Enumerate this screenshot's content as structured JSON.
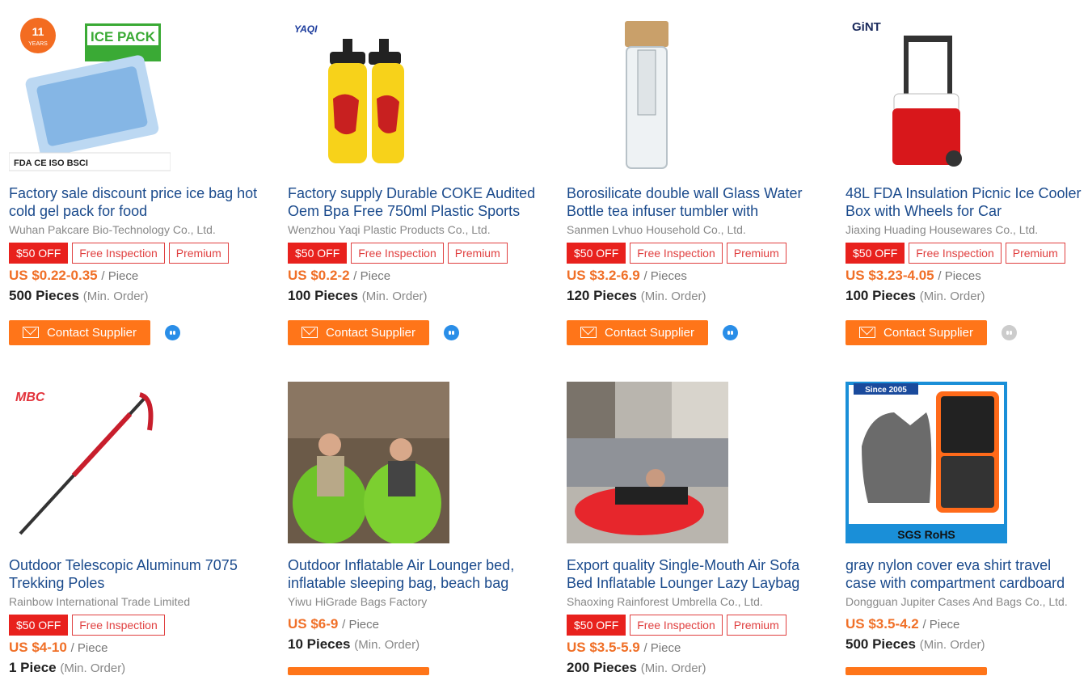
{
  "products": [
    {
      "title": "Factory sale discount price ice bag hot cold gel pack for food",
      "company": "Wuhan Pakcare Bio-Technology Co., Ltd.",
      "tags": [
        "$50 OFF",
        "Free Inspection",
        "Premium"
      ],
      "price": "US $0.22-0.35",
      "unit": "/ Piece",
      "moq": "500 Pieces",
      "moq_note": "(Min. Order)",
      "contact": "Contact Supplier",
      "chat": "blue"
    },
    {
      "title": "Factory supply Durable COKE Audited Oem Bpa Free 750ml Plastic Sports",
      "company": "Wenzhou Yaqi Plastic Products Co., Ltd.",
      "tags": [
        "$50 OFF",
        "Free Inspection",
        "Premium"
      ],
      "price": "US $0.2-2",
      "unit": "/ Piece",
      "moq": "100 Pieces",
      "moq_note": "(Min. Order)",
      "contact": "Contact Supplier",
      "chat": "blue"
    },
    {
      "title": "Borosilicate double wall Glass Water Bottle tea infuser tumbler with",
      "company": "Sanmen Lvhuo Household Co., Ltd.",
      "tags": [
        "$50 OFF",
        "Free Inspection",
        "Premium"
      ],
      "price": "US $3.2-6.9",
      "unit": "/ Pieces",
      "moq": "120 Pieces",
      "moq_note": "(Min. Order)",
      "contact": "Contact Supplier",
      "chat": "blue"
    },
    {
      "title": "48L FDA Insulation Picnic Ice Cooler Box with Wheels for Car",
      "company": "Jiaxing Huading Housewares Co., Ltd.",
      "tags": [
        "$50 OFF",
        "Free Inspection",
        "Premium"
      ],
      "price": "US $3.23-4.05",
      "unit": "/ Pieces",
      "moq": "100 Pieces",
      "moq_note": "(Min. Order)",
      "contact": "Contact Supplier",
      "chat": "gray"
    },
    {
      "title": "Outdoor Telescopic Aluminum 7075 Trekking Poles",
      "company": "Rainbow International Trade Limited",
      "tags": [
        "$50 OFF",
        "Free Inspection"
      ],
      "price": "US $4-10",
      "unit": "/ Piece",
      "moq": "1 Piece",
      "moq_note": "(Min. Order)"
    },
    {
      "title": "Outdoor Inflatable Air Lounger bed, inflatable sleeping bag, beach bag",
      "company": "Yiwu HiGrade Bags Factory",
      "tags": [],
      "price": "US $6-9",
      "unit": "/ Piece",
      "moq": "10 Pieces",
      "moq_note": "(Min. Order)"
    },
    {
      "title": "Export quality Single-Mouth Air Sofa Bed Inflatable Lounger Lazy Laybag",
      "company": "Shaoxing Rainforest Umbrella Co., Ltd.",
      "tags": [
        "$50 OFF",
        "Free Inspection",
        "Premium"
      ],
      "price": "US $3.5-5.9",
      "unit": "/ Piece",
      "moq": "200 Pieces",
      "moq_note": "(Min. Order)"
    },
    {
      "title": "gray nylon cover eva shirt travel case with compartment cardboard",
      "company": "Dongguan Jupiter Cases And Bags Co., Ltd.",
      "tags": [],
      "price": "US $3.5-4.2",
      "unit": "/ Piece",
      "moq": "500 Pieces",
      "moq_note": "(Min. Order)"
    }
  ],
  "image_text": {
    "p0_badge": "11",
    "p0_badge_sub": "YEARS",
    "p0_label": "ICE PACK",
    "p0_certs": "FDA CE ISO BSCI",
    "p1_logo": "YAQI",
    "p3_logo": "GiNT",
    "p4_logo": "MBC",
    "p7_since": "Since 2005",
    "p7_certs": "SGS RoHS"
  }
}
